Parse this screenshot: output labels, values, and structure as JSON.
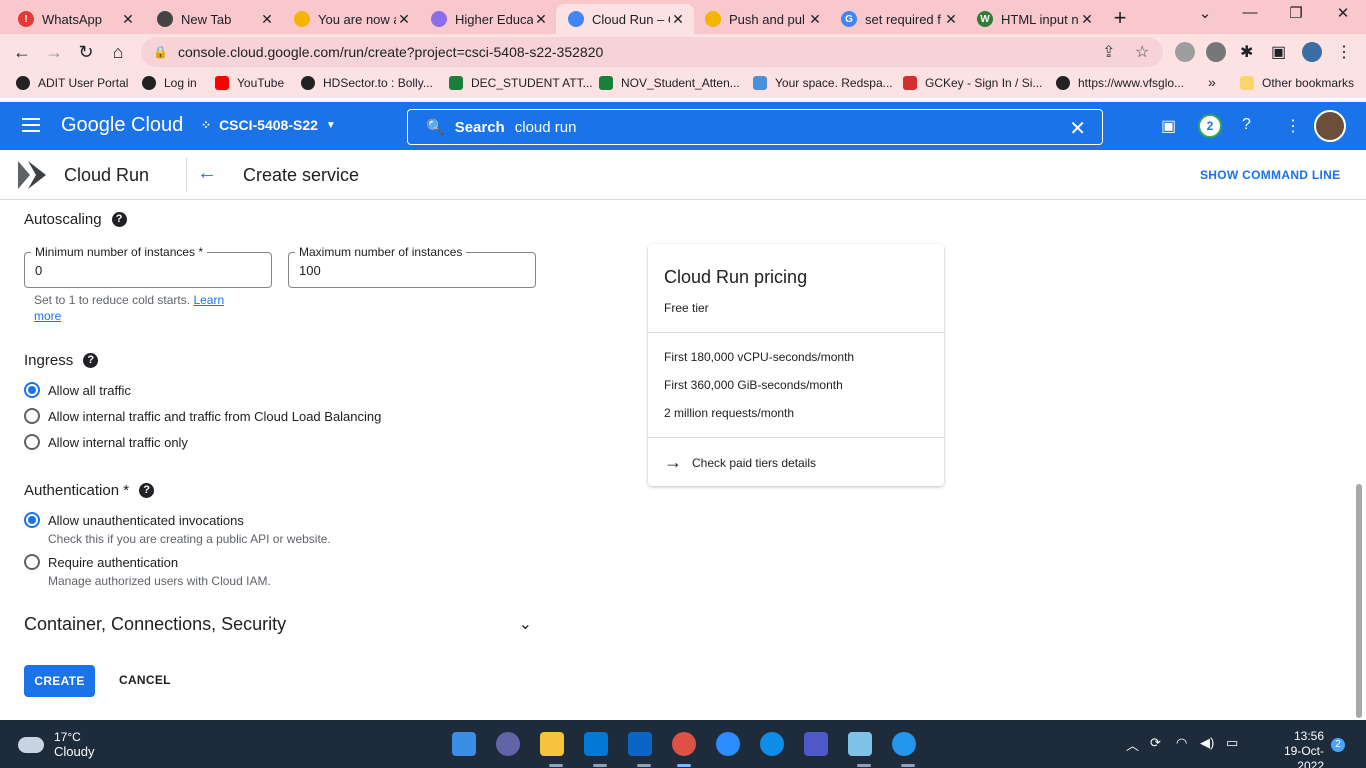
{
  "browser": {
    "tabs": [
      {
        "title": "WhatsApp",
        "color": "#e53935"
      },
      {
        "title": "New Tab",
        "color": "#444444"
      },
      {
        "title": "You are now a",
        "color": "#f4b400"
      },
      {
        "title": "Higher Educa",
        "color": "#8a6de9"
      },
      {
        "title": "Cloud Run – C",
        "color": "#4285f4"
      },
      {
        "title": "Push and pul",
        "color": "#f4b400"
      },
      {
        "title": "set required f",
        "color": "#4285f4"
      },
      {
        "title": "HTML input n",
        "color": "#2e7d32"
      }
    ],
    "url": "console.cloud.google.com/run/create?project=csci-5408-s22-352820",
    "bookmarks": [
      "ADIT User Portal",
      "Log in",
      "YouTube",
      "HDSector.to : Bolly...",
      "DEC_STUDENT ATT...",
      "NOV_Student_Atten...",
      "Your space. Redspa...",
      "GCKey - Sign In / Si...",
      "https://www.vfsglo...",
      "»",
      "Other bookmarks"
    ]
  },
  "gcp": {
    "logo": "Google Cloud",
    "project": "CSCI-5408-S22",
    "search_label": "Search",
    "search_value": "cloud run",
    "notifications": "2"
  },
  "subheader": {
    "product": "Cloud Run",
    "title": "Create service",
    "command_line": "SHOW COMMAND LINE"
  },
  "autoscaling": {
    "title": "Autoscaling",
    "min_label": "Minimum number of instances *",
    "min_value": "0",
    "max_label": "Maximum number of instances",
    "max_value": "100",
    "hint": "Set to 1 to reduce cold starts.",
    "learn_more": "Learn more"
  },
  "ingress": {
    "title": "Ingress",
    "options": [
      "Allow all traffic",
      "Allow internal traffic and traffic from Cloud Load Balancing",
      "Allow internal traffic only"
    ],
    "selected": 0
  },
  "authentication": {
    "title": "Authentication *",
    "options": [
      {
        "label": "Allow unauthenticated invocations",
        "desc": "Check this if you are creating a public API or website."
      },
      {
        "label": "Require authentication",
        "desc": "Manage authorized users with Cloud IAM."
      }
    ],
    "selected": 0
  },
  "expander": {
    "label": "Container, Connections, Security"
  },
  "actions": {
    "create": "CREATE",
    "cancel": "CANCEL"
  },
  "pricing": {
    "title": "Cloud Run pricing",
    "subtitle": "Free tier",
    "lines": [
      "First 180,000 vCPU-seconds/month",
      "First 360,000 GiB-seconds/month",
      "2 million requests/month"
    ],
    "link": "Check paid tiers details"
  },
  "taskbar": {
    "temperature": "17°C",
    "condition": "Cloudy",
    "time": "13:56",
    "date": "19-Oct-2022",
    "notification_count": "2"
  }
}
